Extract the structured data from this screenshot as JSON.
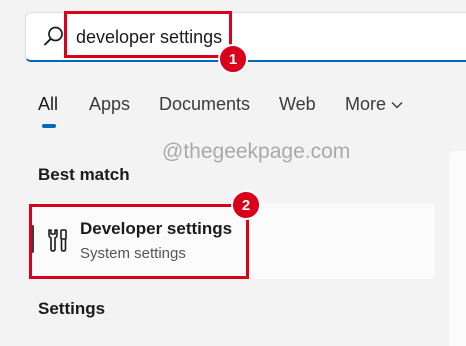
{
  "search": {
    "value": "developer settings",
    "icon": "search-icon"
  },
  "tabs": [
    {
      "label": "All",
      "active": true
    },
    {
      "label": "Apps"
    },
    {
      "label": "Documents"
    },
    {
      "label": "Web"
    },
    {
      "label": "More"
    }
  ],
  "watermark": "@thegeekpage.com",
  "sections": {
    "best_match": "Best match",
    "settings": "Settings"
  },
  "best_result": {
    "title": "Developer settings",
    "subtitle": "System settings",
    "icon": "tools-icon"
  },
  "annotations": {
    "step1": "1",
    "step2": "2",
    "highlight_color": "#d8001b"
  },
  "colors": {
    "accent": "#0067c0",
    "background": "#f3f3f3"
  }
}
